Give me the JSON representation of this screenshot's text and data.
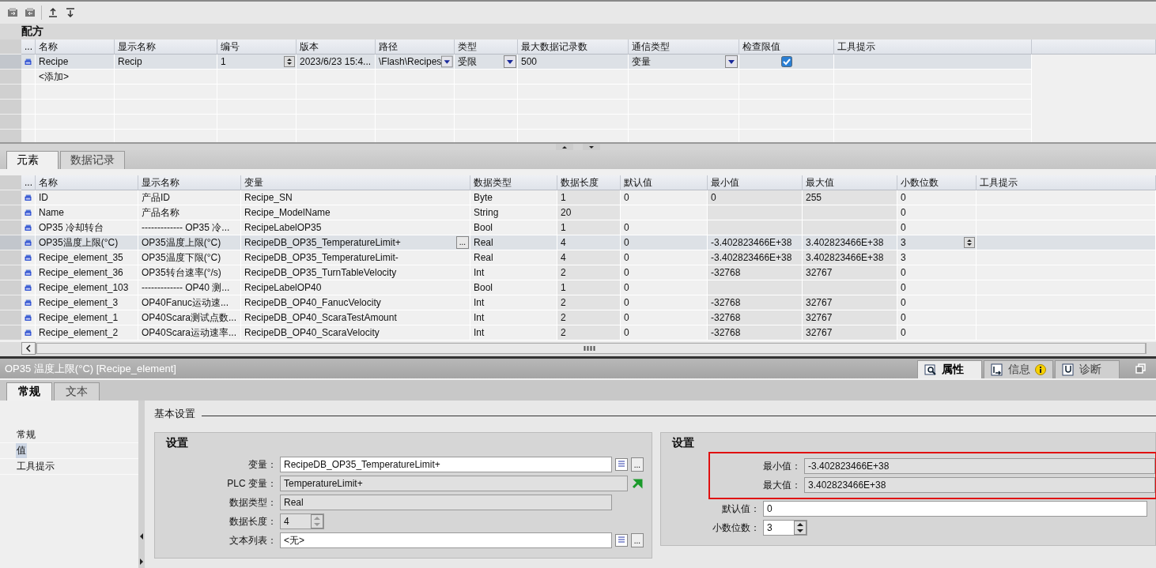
{
  "recipes": {
    "title": "配方",
    "columns": [
      "...",
      "名称",
      "显示名称",
      "编号",
      "版本",
      "路径",
      "类型",
      "最大数据记录数",
      "通信类型",
      "检查限值",
      "工具提示"
    ],
    "rows": [
      {
        "name": "Recipe",
        "display_name": "Recip",
        "number": "1",
        "version": "2023/6/23 15:4...",
        "path": "\\Flash\\Recipes",
        "type": "受限",
        "max_records": "500",
        "comm_type": "变量",
        "check_limits": true,
        "selected": true
      }
    ],
    "add_row": "<添加>"
  },
  "element_tabs": [
    {
      "label": "元素",
      "selected": true
    },
    {
      "label": "数据记录",
      "selected": false
    }
  ],
  "elements": {
    "columns": [
      "...",
      "名称",
      "显示名称",
      "变量",
      "数据类型",
      "数据长度",
      "默认值",
      "最小值",
      "最大值",
      "小数位数",
      "工具提示"
    ],
    "rows": [
      {
        "name": "ID",
        "display_name": "产品ID",
        "tag": "Recipe_SN",
        "data_type": "Byte",
        "length": "1",
        "default": "0",
        "min": "0",
        "max": "255",
        "decimals": "0",
        "selected": false
      },
      {
        "name": "Name",
        "display_name": "产品名称",
        "tag": "Recipe_ModelName",
        "data_type": "String",
        "length": "20",
        "default": "",
        "min": "",
        "max": "",
        "decimals": "0",
        "selected": false
      },
      {
        "name": "OP35 冷却转台",
        "display_name": "------------- OP35 冷...",
        "tag": "RecipeLabelOP35",
        "data_type": "Bool",
        "length": "1",
        "default": "0",
        "min": "",
        "max": "",
        "decimals": "0",
        "selected": false
      },
      {
        "name": "OP35温度上限(°C)",
        "display_name": "OP35温度上限(°C)",
        "tag": "RecipeDB_OP35_TemperatureLimit+",
        "data_type": "Real",
        "length": "4",
        "default": "0",
        "min": "-3.402823466E+38",
        "max": "3.402823466E+38",
        "decimals": "3",
        "selected": true
      },
      {
        "name": "Recipe_element_35",
        "display_name": "OP35温度下限(°C)",
        "tag": "RecipeDB_OP35_TemperatureLimit-",
        "data_type": "Real",
        "length": "4",
        "default": "0",
        "min": "-3.402823466E+38",
        "max": "3.402823466E+38",
        "decimals": "3",
        "selected": false
      },
      {
        "name": "Recipe_element_36",
        "display_name": "OP35转台速率(°/s)",
        "tag": "RecipeDB_OP35_TurnTableVelocity",
        "data_type": "Int",
        "length": "2",
        "default": "0",
        "min": "-32768",
        "max": "32767",
        "decimals": "0",
        "selected": false
      },
      {
        "name": "Recipe_element_103",
        "display_name": "------------- OP40 测...",
        "tag": "RecipeLabelOP40",
        "data_type": "Bool",
        "length": "1",
        "default": "0",
        "min": "",
        "max": "",
        "decimals": "0",
        "selected": false
      },
      {
        "name": "Recipe_element_3",
        "display_name": "OP40Fanuc运动速...",
        "tag": "RecipeDB_OP40_FanucVelocity",
        "data_type": "Int",
        "length": "2",
        "default": "0",
        "min": "-32768",
        "max": "32767",
        "decimals": "0",
        "selected": false
      },
      {
        "name": "Recipe_element_1",
        "display_name": "OP40Scara测试点数...",
        "tag": "RecipeDB_OP40_ScaraTestAmount",
        "data_type": "Int",
        "length": "2",
        "default": "0",
        "min": "-32768",
        "max": "32767",
        "decimals": "0",
        "selected": false
      },
      {
        "name": "Recipe_element_2",
        "display_name": "OP40Scara运动速率...",
        "tag": "RecipeDB_OP40_ScaraVelocity",
        "data_type": "Int",
        "length": "2",
        "default": "0",
        "min": "-32768",
        "max": "32767",
        "decimals": "0",
        "selected": false
      }
    ]
  },
  "properties": {
    "title": "OP35 温度上限(°C) [Recipe_element]",
    "view_tabs": [
      {
        "label": "属性",
        "selected": true
      },
      {
        "label": "信息",
        "selected": false
      },
      {
        "label": "诊断",
        "selected": false
      }
    ],
    "tabs": [
      {
        "label": "常规",
        "selected": true
      },
      {
        "label": "文本",
        "selected": false
      }
    ],
    "nav": [
      {
        "label": "常规",
        "selected": false
      },
      {
        "label": "值",
        "selected": true
      },
      {
        "label": "工具提示",
        "selected": false
      }
    ],
    "section": "基本设置",
    "left_group": {
      "title": "设置",
      "fields": [
        {
          "label": "变量：",
          "value": "RecipeDB_OP35_TemperatureLimit+",
          "kind": "browse"
        },
        {
          "label": "PLC 变量：",
          "value": "TemperatureLimit+",
          "kind": "link"
        },
        {
          "label": "数据类型：",
          "value": "Real",
          "kind": "readonly"
        },
        {
          "label": "数据长度：",
          "value": "4",
          "kind": "spin_readonly"
        },
        {
          "label": "文本列表：",
          "value": "<无>",
          "kind": "browse"
        }
      ]
    },
    "right_group": {
      "title": "设置",
      "highlighted_fields": [
        {
          "label": "最小值：",
          "value": "-3.402823466E+38",
          "kind": "readonly"
        },
        {
          "label": "最大值：",
          "value": "3.402823466E+38",
          "kind": "readonly"
        }
      ],
      "fields": [
        {
          "label": "默认值：",
          "value": "0",
          "kind": "text"
        },
        {
          "label": "小数位数：",
          "value": "3",
          "kind": "spin"
        }
      ]
    }
  }
}
